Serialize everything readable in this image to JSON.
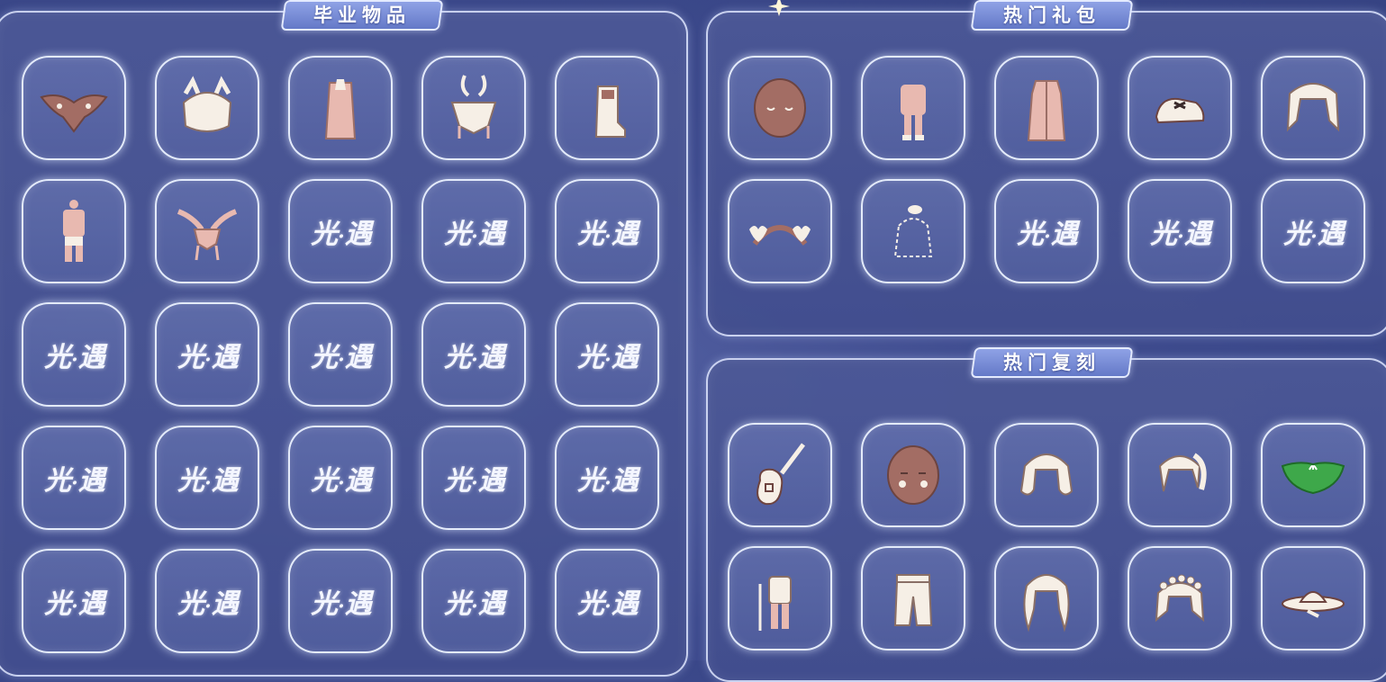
{
  "panels": {
    "graduation": {
      "title": "毕业物品"
    },
    "hot_gifts": {
      "title": "热门礼包"
    },
    "hot_reprints": {
      "title": "热门复刻"
    }
  },
  "placeholder_logo": {
    "left": "光",
    "dot": "·",
    "right": "遇"
  },
  "graduation_items": [
    "wing-cape-icon",
    "horned-hair-icon",
    "long-cape-icon",
    "antler-mask-icon",
    "boots-icon",
    "outfit-icon",
    "winged-necklace-icon",
    "sky-logo-placeholder",
    "sky-logo-placeholder",
    "sky-logo-placeholder",
    "sky-logo-placeholder",
    "sky-logo-placeholder",
    "sky-logo-placeholder",
    "sky-logo-placeholder",
    "sky-logo-placeholder",
    "sky-logo-placeholder",
    "sky-logo-placeholder",
    "sky-logo-placeholder",
    "sky-logo-placeholder",
    "sky-logo-placeholder",
    "sky-logo-placeholder",
    "sky-logo-placeholder",
    "sky-logo-placeholder",
    "sky-logo-placeholder",
    "sky-logo-placeholder"
  ],
  "hot_gift_items": [
    "mask-closed-eyes-icon",
    "child-outfit-icon",
    "robe-icon",
    "shoes-icon",
    "twin-tail-hair-icon",
    "heart-headband-icon",
    "fairy-outline-icon",
    "sky-logo-placeholder",
    "sky-logo-placeholder",
    "sky-logo-placeholder"
  ],
  "hot_reprint_items": [
    "guitar-icon",
    "blush-mask-icon",
    "wavy-hair-icon",
    "ponytail-hair-icon",
    "green-cape-icon",
    "outfit-with-staff-icon",
    "pants-icon",
    "long-wavy-hair-icon",
    "flower-crown-hair-icon",
    "hat-icon"
  ],
  "colors": {
    "background": "#3f4c8f",
    "slot_border": "#ecf2ff",
    "title_bg": "#7a8ed8",
    "item_pink": "#e8b9b0",
    "item_cream": "#f6efe6",
    "item_brown": "#a36d64",
    "item_green": "#3ea84a"
  }
}
